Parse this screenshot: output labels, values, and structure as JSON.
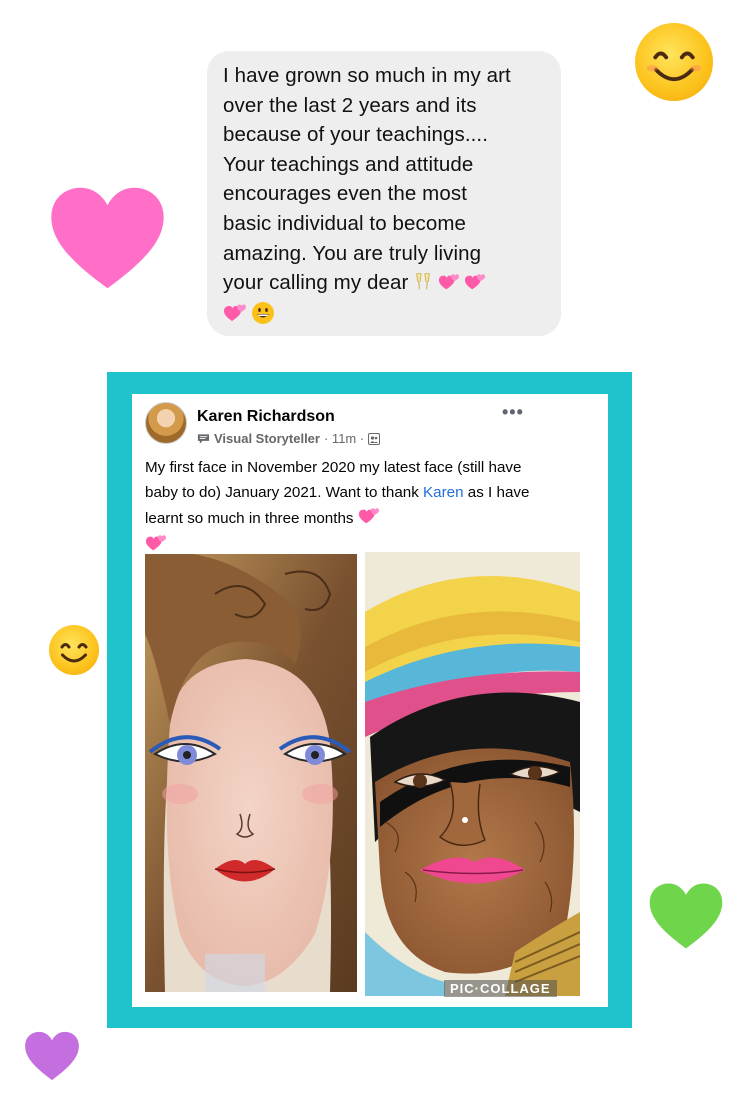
{
  "message": {
    "text": "I have grown so much in my art\nover the last 2 years and its\nbecause of your teachings....\nYour teachings and attitude\nencourages even the most\nbasic individual to become\namazing.  You are truly living\nyour calling my dear",
    "inline_emojis": [
      "champagne-glasses",
      "two-hearts",
      "two-hearts"
    ],
    "trailing_emojis": [
      "two-hearts",
      "grinning-face"
    ]
  },
  "post": {
    "author": "Karen Richardson",
    "badge": "Visual Storyteller",
    "time": "· 11m ·",
    "more": "•••",
    "text_before_link": "My first face in November 2020 my latest face (still have baby to do) January 2021. Want to thank ",
    "link": "Karen",
    "text_after_link": " as I have learnt so much in three months",
    "collage_label": "PIC·COLLAGE"
  },
  "colors": {
    "frame": "#1ec3cc",
    "bubble": "#eeeeef",
    "pink_heart": "#ff6fc8",
    "green_heart": "#6fd54a",
    "purple_heart": "#c46ee0",
    "link": "#216fdb"
  },
  "decorations": [
    "smiling-face-emoji",
    "pink-heart-emoji",
    "smiling-face-emoji",
    "green-heart-emoji",
    "purple-heart-emoji"
  ]
}
